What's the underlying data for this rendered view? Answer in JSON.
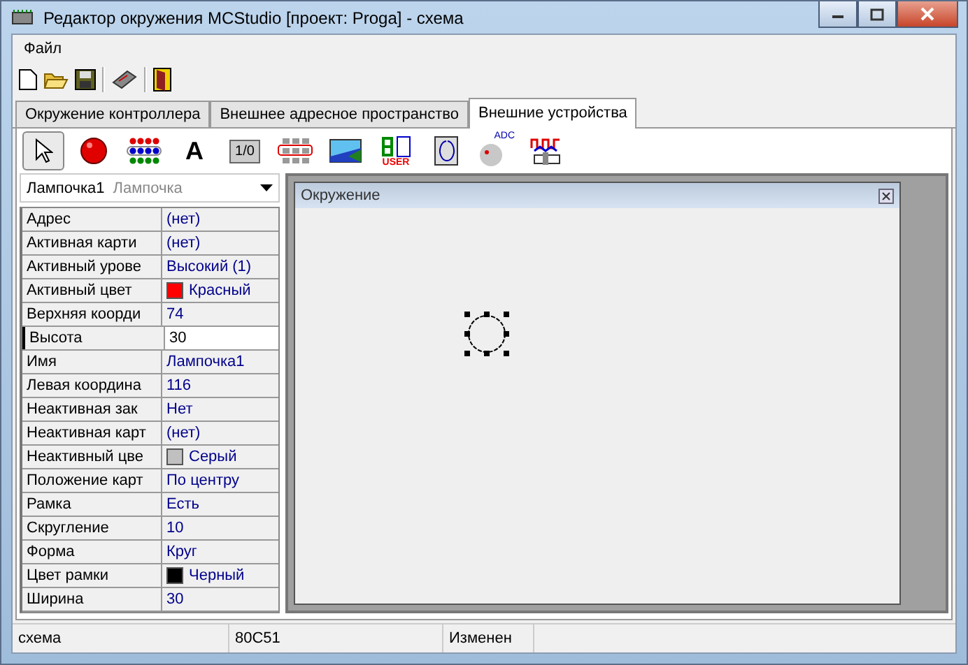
{
  "window": {
    "title": "Редактор окружения MCStudio [проект: Proga] - схема"
  },
  "menu": [
    "Файл"
  ],
  "toolbar": [
    {
      "kind": "new"
    },
    {
      "kind": "open"
    },
    {
      "kind": "save"
    },
    {
      "kind": "sep"
    },
    {
      "kind": "chip"
    },
    {
      "kind": "sep"
    },
    {
      "kind": "exit"
    }
  ],
  "tabs": [
    {
      "label": "Окружение контроллера",
      "selected": false
    },
    {
      "label": "Внешнее адресное пространство",
      "selected": false
    },
    {
      "label": "Внешние устройства",
      "selected": true
    }
  ],
  "palette": [
    {
      "kind": "pointer",
      "selected": true
    },
    {
      "kind": "lamp",
      "selected": false
    },
    {
      "kind": "leds",
      "selected": false
    },
    {
      "kind": "text",
      "label": "A",
      "selected": false
    },
    {
      "kind": "switch",
      "label": "1/0",
      "selected": false
    },
    {
      "kind": "keypad",
      "selected": false
    },
    {
      "kind": "picture",
      "selected": false
    },
    {
      "kind": "segment",
      "label": "USER",
      "selected": false
    },
    {
      "kind": "encoder",
      "selected": false
    },
    {
      "kind": "adc",
      "label": "ADC",
      "selected": false
    },
    {
      "kind": "signal",
      "selected": false
    }
  ],
  "object_selector": {
    "name": "Лампочка1",
    "type": "Лампочка"
  },
  "properties": [
    {
      "name": "Адрес",
      "value": "(нет)",
      "selected": false
    },
    {
      "name": "Активная карти",
      "value": "(нет)",
      "selected": false
    },
    {
      "name": "Активный урове",
      "value": "Высокий (1)",
      "selected": false
    },
    {
      "name": "Активный цвет",
      "value": "Красный",
      "color": "#ff0000",
      "selected": false
    },
    {
      "name": "Верхняя коорди",
      "value": "74",
      "selected": false
    },
    {
      "name": "Высота",
      "value": "30",
      "selected": true
    },
    {
      "name": "Имя",
      "value": "Лампочка1",
      "selected": false
    },
    {
      "name": "Левая координа",
      "value": "116",
      "selected": false
    },
    {
      "name": "Неактивная зак",
      "value": "Нет",
      "selected": false
    },
    {
      "name": "Неактивная карт",
      "value": "(нет)",
      "selected": false
    },
    {
      "name": "Неактивный цве",
      "value": "Серый",
      "color": "#c0c0c0",
      "selected": false
    },
    {
      "name": "Положение карт",
      "value": "По центру",
      "selected": false
    },
    {
      "name": "Рамка",
      "value": "Есть",
      "selected": false
    },
    {
      "name": "Скругление",
      "value": "10",
      "selected": false
    },
    {
      "name": "Форма",
      "value": "Круг",
      "selected": false
    },
    {
      "name": "Цвет рамки",
      "value": "Черный",
      "color": "#000000",
      "selected": false
    },
    {
      "name": "Ширина",
      "value": "30",
      "selected": false
    }
  ],
  "canvas_window": {
    "title": "Окружение"
  },
  "status_bar": [
    "схема",
    "80C51",
    "Изменен"
  ]
}
